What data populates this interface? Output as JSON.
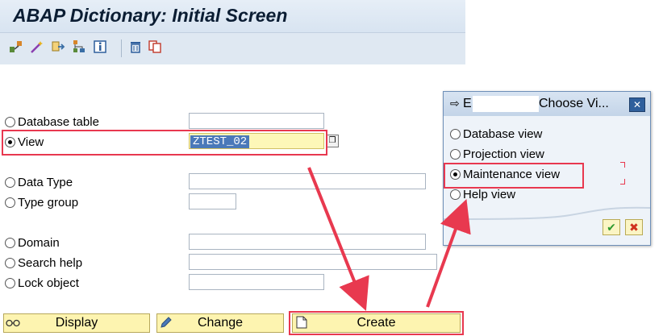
{
  "window": {
    "title": "ABAP Dictionary: Initial Screen"
  },
  "toolbar": {
    "icons": [
      "other-object-icon",
      "magic-wand-icon",
      "copy-object-icon",
      "where-used-icon",
      "info-icon",
      "delete-icon",
      "copy-icon"
    ]
  },
  "options": [
    {
      "label": "Database table",
      "selected": false,
      "value": ""
    },
    {
      "label": "View",
      "selected": true,
      "value": "ZTEST_02"
    },
    {
      "label": "Data Type",
      "selected": false,
      "value": ""
    },
    {
      "label": "Type group",
      "selected": false,
      "value": ""
    },
    {
      "label": "Domain",
      "selected": false,
      "value": ""
    },
    {
      "label": "Search help",
      "selected": false,
      "value": ""
    },
    {
      "label": "Lock object",
      "selected": false,
      "value": ""
    }
  ],
  "buttons": {
    "display": "Display",
    "change": "Change",
    "create": "Create"
  },
  "popup": {
    "title": "Choose Vi...",
    "title_prefix": "E",
    "options": [
      {
        "label": "Database view",
        "selected": false
      },
      {
        "label": "Projection view",
        "selected": false
      },
      {
        "label": "Maintenance view",
        "selected": true
      },
      {
        "label": "Help view",
        "selected": false
      }
    ],
    "confirm_icon": "checkmark-icon",
    "cancel_icon": "cancel-x-icon"
  },
  "colors": {
    "highlight": "#e8384f",
    "button_bg": "#fdf4b0",
    "selection": "#4a79b9"
  }
}
